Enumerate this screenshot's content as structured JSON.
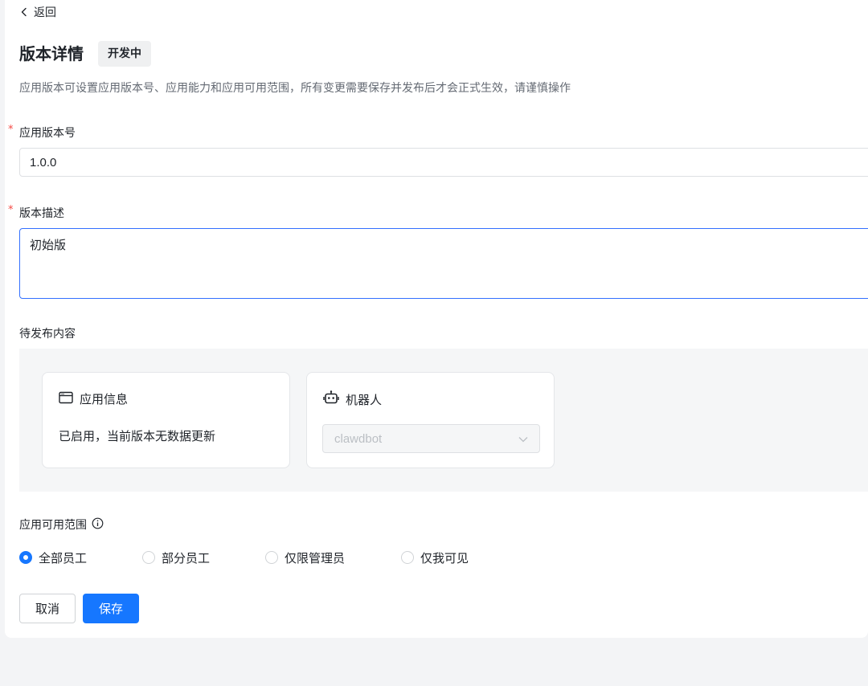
{
  "nav": {
    "back_label": "返回"
  },
  "header": {
    "title": "版本详情",
    "status_badge": "开发中",
    "description": "应用版本可设置应用版本号、应用能力和应用可用范围，所有变更需要保存并发布后才会正式生效，请谨慎操作"
  },
  "form": {
    "required_mark": "*",
    "version": {
      "label": "应用版本号",
      "value": "1.0.0"
    },
    "description": {
      "label": "版本描述",
      "value": "初始版"
    }
  },
  "pending": {
    "title": "待发布内容",
    "app_info": {
      "icon": "window-icon",
      "title": "应用信息",
      "text": "已启用，当前版本无数据更新"
    },
    "bot": {
      "icon": "robot-icon",
      "title": "机器人",
      "select_value": "clawdbot"
    }
  },
  "scope": {
    "label": "应用可用范围",
    "info_icon": "info-icon",
    "options": [
      {
        "label": "全部员工",
        "selected": true
      },
      {
        "label": "部分员工",
        "selected": false
      },
      {
        "label": "仅限管理员",
        "selected": false
      },
      {
        "label": "仅我可见",
        "selected": false
      }
    ]
  },
  "actions": {
    "cancel_label": "取消",
    "save_label": "保存"
  },
  "colors": {
    "primary": "#1677ff",
    "required": "#f54a45",
    "focus_border": "#3370ff"
  }
}
